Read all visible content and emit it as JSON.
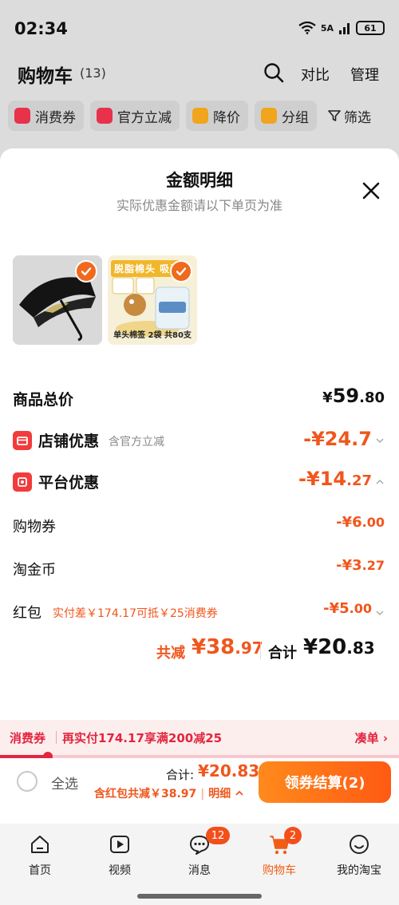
{
  "status_bar": {
    "time": "02:34",
    "network": "5A",
    "battery": "61"
  },
  "cart_header": {
    "title": "购物车",
    "count": "(13)",
    "compare_label": "对比",
    "manage_label": "管理"
  },
  "filters": {
    "items": [
      {
        "label": "消费券",
        "icon": "coupon-icon",
        "color": "#e8314a"
      },
      {
        "label": "官方立减",
        "icon": "lightning-icon",
        "color": "#e8314a"
      },
      {
        "label": "降价",
        "icon": "price-drop-icon",
        "color": "#f0a51c"
      },
      {
        "label": "分组",
        "icon": "folder-icon",
        "color": "#f0a51c"
      }
    ],
    "filter_label": "筛选"
  },
  "sheet": {
    "title": "金额明细",
    "subtitle": "实际优惠金额请以下单页为准",
    "thumb2_banner": "脱脂棉头 吸油",
    "thumb2_caption": "单头棉签 2袋 共80支"
  },
  "breakdown": {
    "goods_total": {
      "label": "商品总价",
      "currency": "¥",
      "int": "59",
      "dec": ".80"
    },
    "store_discount": {
      "label": "店铺优惠",
      "note": "含官方立减",
      "value": "-¥24.7"
    },
    "platform_discount": {
      "label": "平台优惠",
      "value_int": "-¥14",
      "value_dec": ".27"
    },
    "shopping_coupon": {
      "label": "购物券",
      "value_int": "-¥6",
      "value_dec": ".00"
    },
    "taojin_coin": {
      "label": "淘金币",
      "value_int": "-¥3",
      "value_dec": ".27"
    },
    "red_packet": {
      "label": "红包",
      "note": "实付差￥174.17可抵￥25消费券",
      "value_int": "-¥5",
      "value_dec": ".00"
    }
  },
  "summary": {
    "save_label": "共减",
    "save_int": "¥38",
    "save_dec": ".97",
    "total_label": "合计",
    "total_int": "¥20",
    "total_dec": ".83"
  },
  "promo": {
    "tag": "消费券",
    "text": "再实付174.17享满200减25",
    "link": "凑单 ›",
    "progress": 0.12
  },
  "checkout": {
    "select_all": "全选",
    "total_label": "合计:",
    "total_value": "¥20.83",
    "sub_text": "含红包共减￥38.97",
    "detail_label": "明细",
    "button_label": "领券结算(2)"
  },
  "tabbar": {
    "items": [
      {
        "label": "首页",
        "icon": "home-icon"
      },
      {
        "label": "视频",
        "icon": "video-icon"
      },
      {
        "label": "消息",
        "icon": "message-icon",
        "badge": "12"
      },
      {
        "label": "购物车",
        "icon": "cart-icon",
        "badge": "2",
        "active": true
      },
      {
        "label": "我的淘宝",
        "icon": "profile-icon"
      }
    ]
  },
  "colors": {
    "accent": "#f0561c",
    "promo_red": "#e2263e",
    "check_orange": "#f06a1d"
  }
}
